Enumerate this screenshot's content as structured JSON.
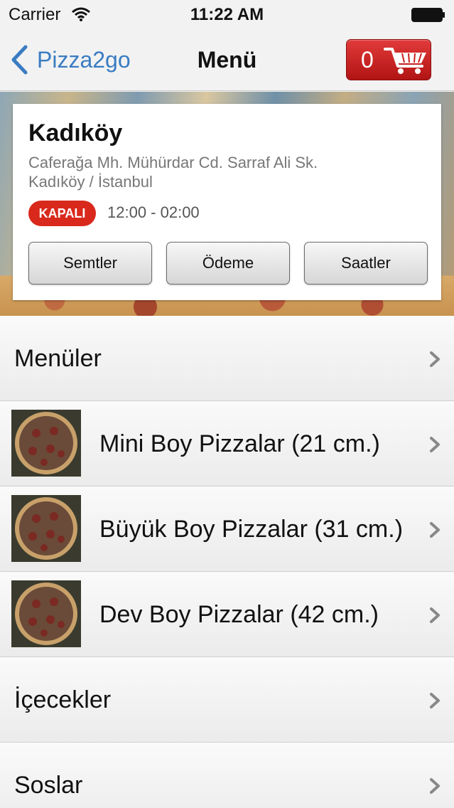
{
  "status_bar": {
    "carrier": "Carrier",
    "time": "11:22 AM"
  },
  "nav": {
    "back_label": "Pizza2go",
    "title": "Menü",
    "cart_count": "0"
  },
  "store": {
    "name": "Kadıköy",
    "address_line1": "Caferağa Mh. Mühürdar Cd. Sarraf Ali Sk.",
    "address_line2": "Kadıköy / İstanbul",
    "status": "KAPALI",
    "hours": "12:00 - 02:00",
    "buttons": [
      "Semtler",
      "Ödeme",
      "Saatler"
    ]
  },
  "menu": {
    "items": [
      {
        "label": "Menüler",
        "thumbnail": false
      },
      {
        "label": "Mini Boy Pizzalar (21 cm.)",
        "thumbnail": true
      },
      {
        "label": "Büyük Boy Pizzalar (31 cm.)",
        "thumbnail": true
      },
      {
        "label": "Dev Boy Pizzalar (42 cm.)",
        "thumbnail": true
      },
      {
        "label": "İçecekler",
        "thumbnail": false
      },
      {
        "label": "Soslar",
        "thumbnail": false
      }
    ]
  },
  "colors": {
    "accent_blue": "#3a7cc2",
    "cart_red": "#c81f1f",
    "badge_red": "#d9291c"
  }
}
